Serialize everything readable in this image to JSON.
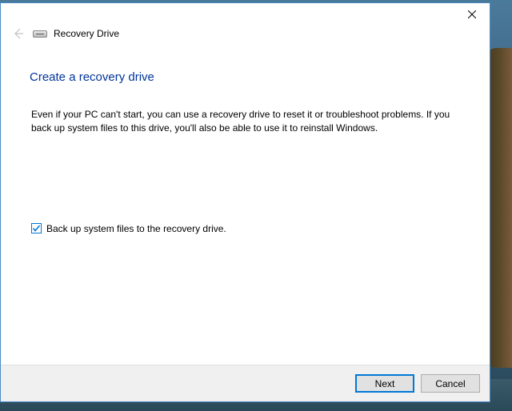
{
  "window": {
    "title": "Recovery Drive"
  },
  "content": {
    "heading": "Create a recovery drive",
    "body": "Even if your PC can't start, you can use a recovery drive to reset it or troubleshoot problems. If you back up system files to this drive, you'll also be able to use it to reinstall Windows.",
    "checkbox_label": "Back up system files to the recovery drive.",
    "checkbox_checked": true
  },
  "footer": {
    "next_label": "Next",
    "cancel_label": "Cancel"
  }
}
